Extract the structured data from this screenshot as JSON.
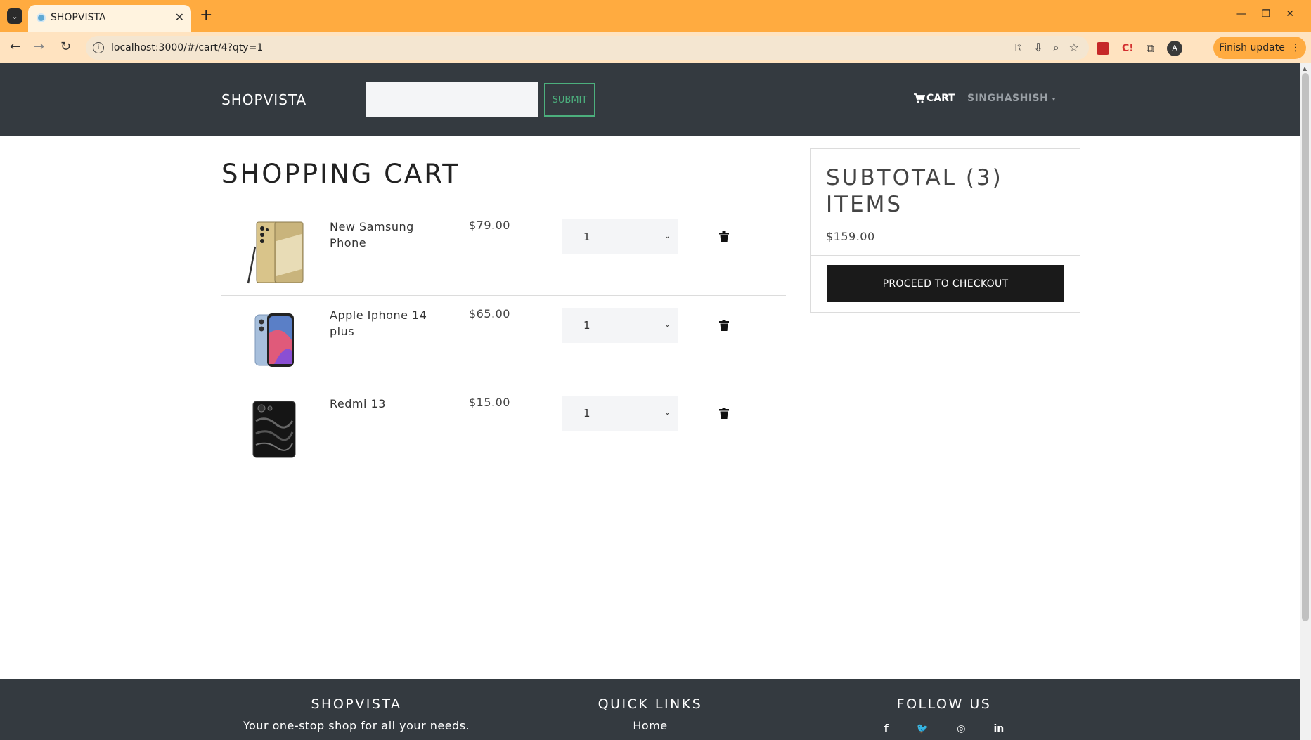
{
  "browser": {
    "tab_title": "SHOPVISTA",
    "url": "localhost:3000/#/cart/4?qty=1",
    "update_label": "Finish update",
    "avatar_letter": "A"
  },
  "navbar": {
    "brand": "SHOPVISTA",
    "search_placeholder": "",
    "submit_label": "SUBMIT",
    "cart_label": "CART",
    "user_label": "SINGHASHISH"
  },
  "cart": {
    "title": "SHOPPING CART",
    "items": [
      {
        "name": "New Samsung Phone",
        "price": "$79.00",
        "qty": "1"
      },
      {
        "name": "Apple Iphone 14 plus",
        "price": "$65.00",
        "qty": "1"
      },
      {
        "name": "Redmi 13",
        "price": "$15.00",
        "qty": "1"
      }
    ]
  },
  "summary": {
    "title": "SUBTOTAL (3) ITEMS",
    "total": "$159.00",
    "checkout_label": "PROCEED TO CHECKOUT"
  },
  "footer": {
    "about_heading": "SHOPVISTA",
    "about_text": "Your one-stop shop for all your needs.",
    "links_heading": "QUICK LINKS",
    "links": [
      "Home"
    ],
    "follow_heading": "FOLLOW US",
    "social": [
      {
        "icon": "facebook-icon",
        "glyph": "f"
      },
      {
        "icon": "twitter-icon",
        "glyph": "🐦"
      },
      {
        "icon": "instagram-icon",
        "glyph": "◎"
      },
      {
        "icon": "linkedin-icon",
        "glyph": "in"
      }
    ]
  },
  "colors": {
    "tab_strip": "#ffab40",
    "navbar": "#343a40",
    "submit_green": "#4caf7d",
    "checkout_button": "#1a1a1a"
  }
}
